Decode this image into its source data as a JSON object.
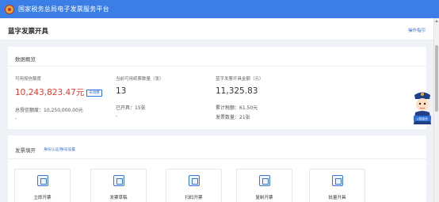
{
  "app": {
    "title": "国家税务总局电子发票服务平台"
  },
  "header": {
    "page_title": "蓝字发票开具",
    "guide_link": "操作指引"
  },
  "overview": {
    "title": "数据概览",
    "credit": {
      "label": "可用授信额度",
      "value": "10,243,823.47元",
      "adjust_label": "去调整",
      "total_label": "总授信额度：",
      "total_value": "10,250,000.00元",
      "dash": "-"
    },
    "count": {
      "label": "当前可用纸票数量（张）",
      "value": "13",
      "issued_label": "已开具：",
      "issued_value": "15张",
      "dash": "-"
    },
    "amount": {
      "label": "蓝字发票开具金额（元）",
      "value": "11,325.83",
      "tax_label": "累计税额：",
      "tax_value": "61.50元",
      "num_label": "发票数量：",
      "num_value": "21张"
    }
  },
  "issue": {
    "title": "发票填开",
    "link": "身份认证/税号设置",
    "cards": [
      {
        "label": "立即开票",
        "icon": "invoice-icon"
      },
      {
        "label": "发票草稿",
        "icon": "draft-icon"
      },
      {
        "label": "扫码开票",
        "icon": "qr-scan-icon"
      },
      {
        "label": "复制开票",
        "icon": "copy-icon"
      },
      {
        "label": "批量开具",
        "icon": "batch-icon"
      }
    ]
  },
  "avatar": {
    "badge": "E税服务"
  },
  "colors": {
    "brand": "#3b7ee5",
    "highlight": "#e23b2e",
    "link": "#2f6fd6"
  }
}
